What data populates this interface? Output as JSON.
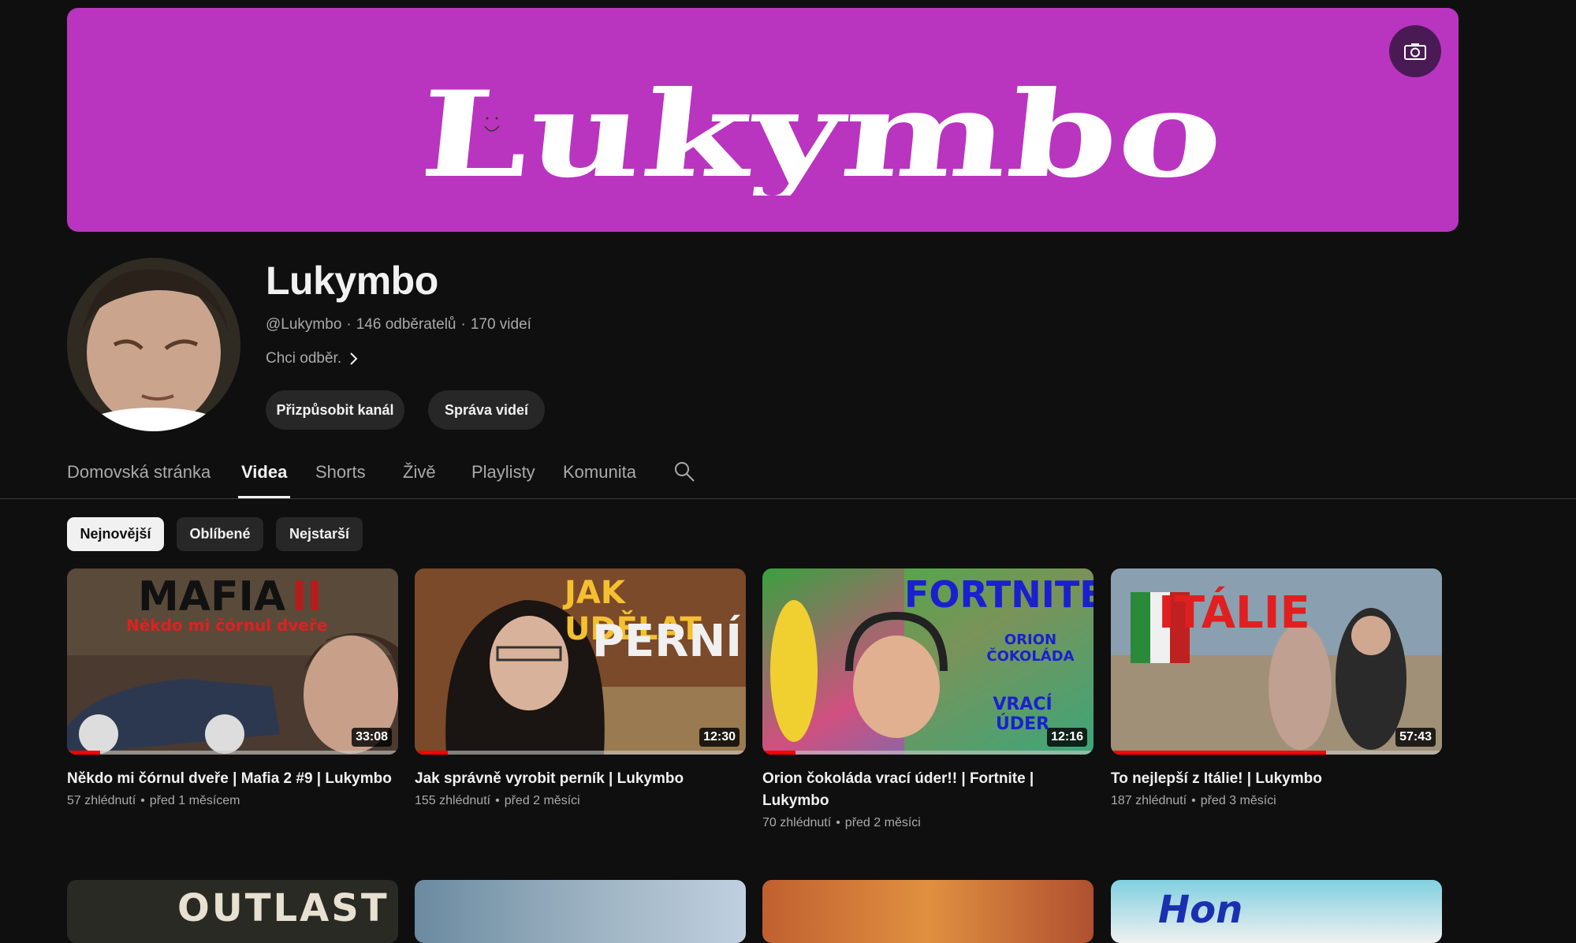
{
  "channel": {
    "banner_text": "Lukymbo",
    "name": "Lukymbo",
    "handle": "@Lukymbo",
    "subscribers": "146 odběratelů",
    "videos_count": "170 videí",
    "description": "Chci odběr.",
    "customize_label": "Přizpůsobit kanál",
    "manage_label": "Správa videí",
    "banner_color": "#b935bf"
  },
  "tabs": [
    {
      "label": "Domovská stránka"
    },
    {
      "label": "Videa"
    },
    {
      "label": "Shorts"
    },
    {
      "label": "Živě"
    },
    {
      "label": "Playlisty"
    },
    {
      "label": "Komunita"
    }
  ],
  "active_tab": "Videa",
  "sort_chips": [
    {
      "label": "Nejnovější"
    },
    {
      "label": "Oblíbené"
    },
    {
      "label": "Nejstarší"
    }
  ],
  "active_chip": "Nejnovější",
  "videos": [
    {
      "title": "Někdo mi čórnul dveře | Mafia 2 #9 | Lukymbo",
      "views": "57 zhlédnutí",
      "age": "před 1 měsícem",
      "duration": "33:08",
      "watched": 0.1,
      "thumb_text_1": "MAFIA",
      "thumb_text_1b": "II",
      "thumb_text_2": "Někdo mi čórnul dveře"
    },
    {
      "title": "Jak správně vyrobit perník | Lukymbo",
      "views": "155 zhlédnutí",
      "age": "před 2 měsíci",
      "duration": "12:30",
      "watched": 0.1,
      "thumb_text_1": "JAK UDĚLAT",
      "thumb_text_2": "PERNÍK"
    },
    {
      "title": "Orion čokoláda vrací úder!! | Fortnite | Lukymbo",
      "views": "70 zhlédnutí",
      "age": "před 2 měsíci",
      "duration": "12:16",
      "watched": 0.1,
      "thumb_text_1": "FORTNITE",
      "thumb_text_2": "ORION ČOKOLÁDA",
      "thumb_text_3": "VRACÍ ÚDER"
    },
    {
      "title": "To nejlepší z Itálie! | Lukymbo",
      "views": "187 zhlédnutí",
      "age": "před 3 měsíci",
      "duration": "57:43",
      "watched": 0.65,
      "thumb_text_1": "ITÁLIE"
    }
  ],
  "next_row": [
    {
      "thumb_text": "OUTLAST"
    },
    {
      "thumb_text": ""
    },
    {
      "thumb_text": ""
    },
    {
      "thumb_text": "Hon"
    }
  ]
}
